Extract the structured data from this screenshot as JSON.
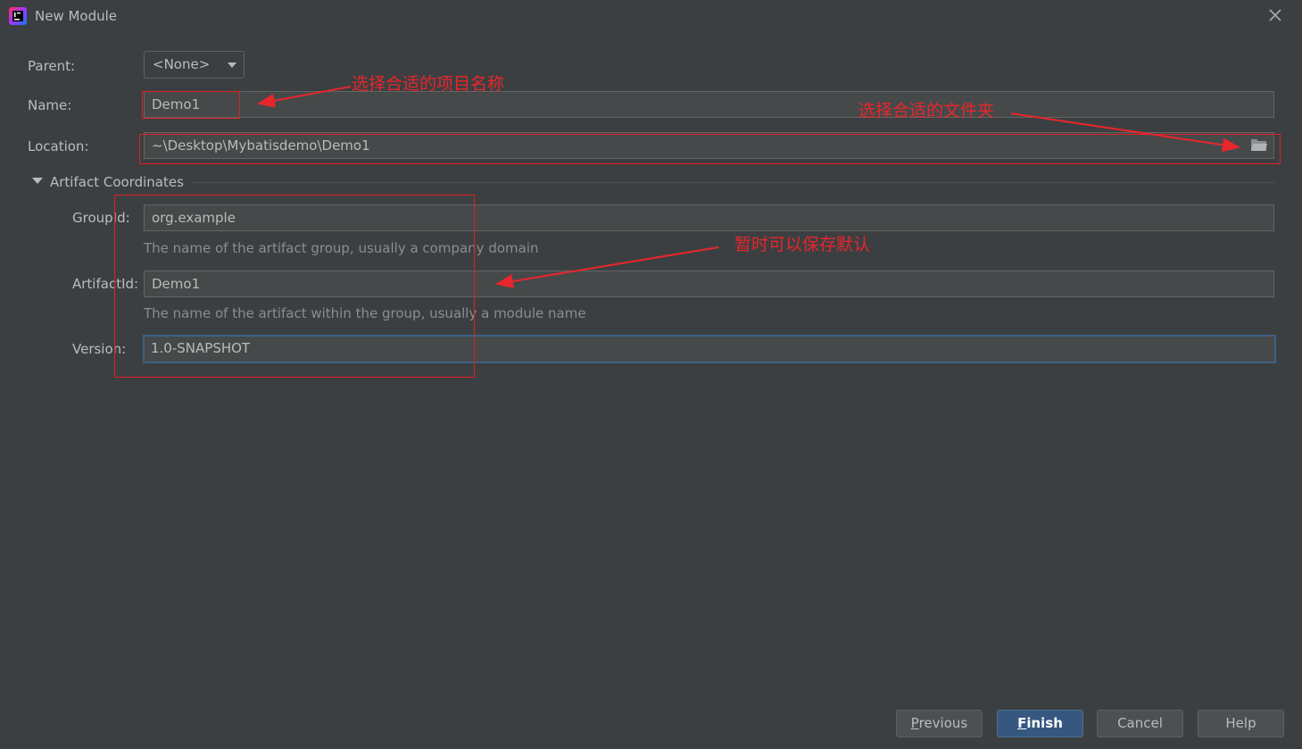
{
  "window": {
    "title": "New Module",
    "app_icon": "intellij-icon",
    "close_icon": "close-icon"
  },
  "form": {
    "parent": {
      "label": "Parent:",
      "value": "<None>"
    },
    "name": {
      "label": "Name:",
      "value": "Demo1"
    },
    "location": {
      "label": "Location:",
      "value": "~\\Desktop\\Mybatisdemo\\Demo1",
      "browse_icon": "folder-icon"
    },
    "section": {
      "title": "Artifact Coordinates",
      "expanded": true
    },
    "group_id": {
      "label": "GroupId:",
      "value": "org.example",
      "hint": "The name of the artifact group, usually a company domain"
    },
    "artifact_id": {
      "label": "ArtifactId:",
      "value": "Demo1",
      "hint": "The name of the artifact within the group, usually a module name"
    },
    "version": {
      "label": "Version:",
      "value": "1.0-SNAPSHOT"
    }
  },
  "buttons": {
    "previous": {
      "mnemonic": "P",
      "rest": "revious"
    },
    "finish": {
      "mnemonic": "F",
      "rest": "inish"
    },
    "cancel": "Cancel",
    "help": "Help"
  },
  "annotations": {
    "name_note": "选择合适的项目名称",
    "location_note": "选择合适的文件夹",
    "artifact_note": "暂时可以保存默认"
  },
  "colors": {
    "background": "#3c3f41",
    "field_bg": "#45494a",
    "accent": "#365880",
    "annotation": "#e8262b"
  }
}
